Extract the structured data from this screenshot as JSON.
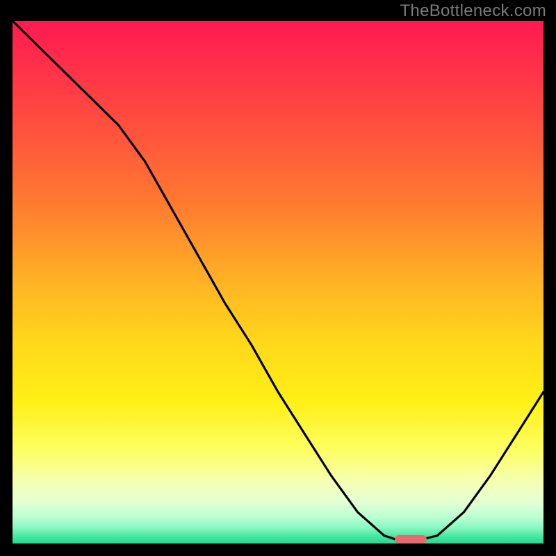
{
  "watermark_text": "TheBottleneck.com",
  "colors": {
    "black": "#000000",
    "curve": "#000000",
    "marker_fill": "#e86a6f",
    "gradient_stops": [
      {
        "offset": 0.0,
        "color": "#ff1a50"
      },
      {
        "offset": 0.08,
        "color": "#ff2e4a"
      },
      {
        "offset": 0.2,
        "color": "#ff4f3e"
      },
      {
        "offset": 0.35,
        "color": "#ff7a30"
      },
      {
        "offset": 0.5,
        "color": "#ffb324"
      },
      {
        "offset": 0.62,
        "color": "#ffd91a"
      },
      {
        "offset": 0.73,
        "color": "#fff016"
      },
      {
        "offset": 0.82,
        "color": "#fdff60"
      },
      {
        "offset": 0.88,
        "color": "#f6ffb0"
      },
      {
        "offset": 0.92,
        "color": "#e4ffd4"
      },
      {
        "offset": 0.95,
        "color": "#baffd2"
      },
      {
        "offset": 0.97,
        "color": "#88f7c0"
      },
      {
        "offset": 0.985,
        "color": "#4de8a4"
      },
      {
        "offset": 1.0,
        "color": "#21d98f"
      }
    ]
  },
  "chart_data": {
    "type": "line",
    "title": "",
    "xlabel": "",
    "ylabel": "",
    "xlim": [
      0,
      100
    ],
    "ylim": [
      0,
      100
    ],
    "x": [
      0,
      5,
      10,
      15,
      20,
      25,
      30,
      35,
      40,
      45,
      50,
      55,
      60,
      65,
      70,
      73,
      76,
      80,
      85,
      90,
      95,
      100
    ],
    "values": [
      100,
      95,
      90,
      85,
      80,
      73,
      64,
      55,
      46,
      38,
      29,
      21,
      13,
      6,
      1.5,
      0.5,
      0.5,
      1.5,
      6,
      13,
      21,
      29
    ],
    "optimal_marker": {
      "x_start": 72,
      "x_end": 78,
      "y": 0.8
    },
    "annotations": []
  }
}
